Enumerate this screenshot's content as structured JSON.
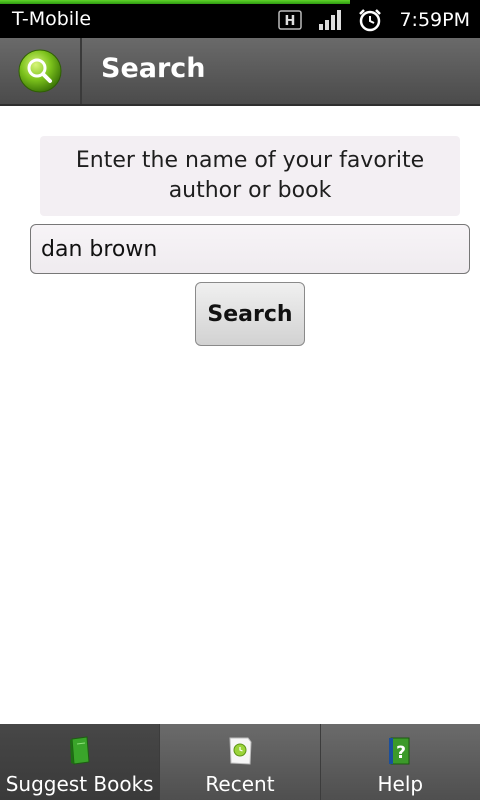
{
  "status_bar": {
    "carrier": "T-Mobile",
    "network_badge": "H",
    "time": "7:59PM",
    "icons": [
      "network-h-icon",
      "signal-bars-icon",
      "alarm-clock-icon"
    ]
  },
  "title_bar": {
    "title": "Search",
    "icon": "magnifier-logo-icon"
  },
  "content": {
    "prompt": "Enter the name of your favorite author or book",
    "search_value": "dan brown",
    "search_button_label": "Search"
  },
  "tabs": [
    {
      "label": "Suggest Books",
      "icon": "green-book-icon",
      "active": true
    },
    {
      "label": "Recent",
      "icon": "recent-note-icon",
      "active": false
    },
    {
      "label": "Help",
      "icon": "help-book-icon",
      "active": false
    }
  ],
  "colors": {
    "accent_green": "#5fd32a",
    "title_bar": "#555555",
    "prompt_bg": "#f3eff3"
  }
}
